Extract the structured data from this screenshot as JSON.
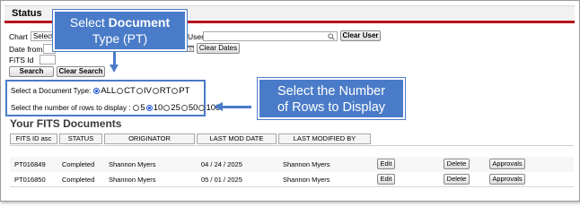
{
  "panel": {
    "title": "Status"
  },
  "filters": {
    "chart_label": "Chart",
    "chart_value": "Select",
    "user_label": "User",
    "user_value": "",
    "clear_user": "Clear User",
    "date_from_label": "Date from",
    "date_from_value": "",
    "clear_dates": "Clear Dates",
    "fits_id_label": "FiTS Id",
    "fits_id_value": "",
    "search": "Search",
    "clear_search": "Clear Search"
  },
  "callouts": {
    "doc_type_prefix": "Select ",
    "doc_type_bold": "Document",
    "doc_type_line2": "Type (PT)",
    "rows_line1": "Select the Number",
    "rows_line2": "of Rows to Display"
  },
  "doc_type": {
    "label": "Select a Document Type:",
    "options": [
      "ALL",
      "CT",
      "IV",
      "RT",
      "PT"
    ],
    "selected": "ALL"
  },
  "rows_to_display": {
    "label": "Select the number of rows to display :",
    "options": [
      "5",
      "10",
      "25",
      "50",
      "100"
    ],
    "selected": "10"
  },
  "documents": {
    "title": "Your FITS Documents",
    "columns": [
      "FITS ID asc",
      "STATUS",
      "ORIGINATOR",
      "LAST MOD DATE",
      "LAST MODIFIED BY"
    ],
    "rows": [
      {
        "id": "PT016849",
        "status": "Completed",
        "originator": "Shannon Myers",
        "date": "04 / 24 / 2025",
        "modified_by": "Shannon Myers",
        "edit": "Edit",
        "delete": "Delete",
        "approvals": "Approvals"
      },
      {
        "id": "PT016850",
        "status": "Completed",
        "originator": "Shannon Myers",
        "date": "05 / 01 / 2025",
        "modified_by": "Shannon Myers",
        "edit": "Edit",
        "delete": "Delete",
        "approvals": "Approvals"
      }
    ]
  },
  "colors": {
    "accent_red": "#b5121b",
    "callout_blue": "#4a7bc8",
    "radio_blue": "#1a4fd6"
  },
  "icons": {
    "search": "magnifier-icon",
    "calendar": "calendar-icon"
  }
}
